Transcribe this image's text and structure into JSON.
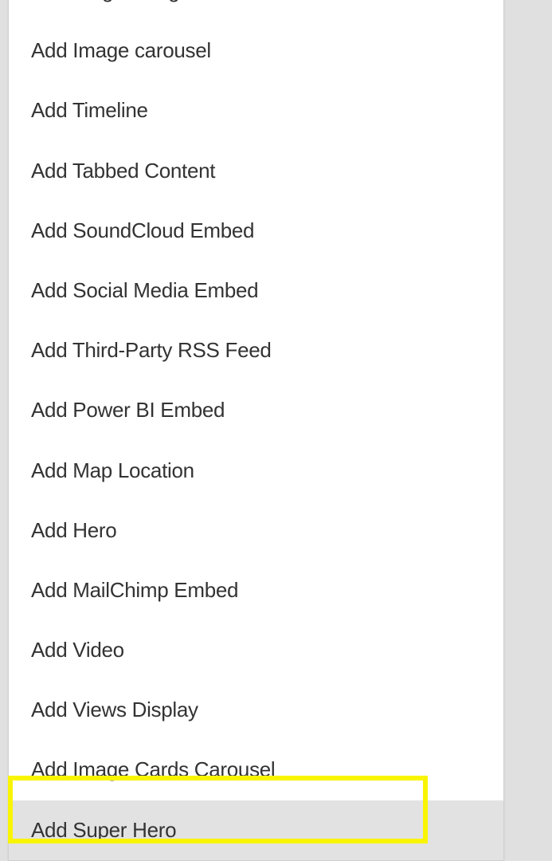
{
  "menu": {
    "items": [
      {
        "label": "Add Single Image",
        "highlighted": false
      },
      {
        "label": "Add Image carousel",
        "highlighted": false
      },
      {
        "label": "Add Timeline",
        "highlighted": false
      },
      {
        "label": "Add Tabbed Content",
        "highlighted": false
      },
      {
        "label": "Add SoundCloud Embed",
        "highlighted": false
      },
      {
        "label": "Add Social Media Embed",
        "highlighted": false
      },
      {
        "label": "Add Third-Party RSS Feed",
        "highlighted": false
      },
      {
        "label": "Add Power BI Embed",
        "highlighted": false
      },
      {
        "label": "Add Map Location",
        "highlighted": false
      },
      {
        "label": "Add Hero",
        "highlighted": false
      },
      {
        "label": "Add MailChimp Embed",
        "highlighted": false
      },
      {
        "label": "Add Video",
        "highlighted": false
      },
      {
        "label": "Add Views Display",
        "highlighted": false
      },
      {
        "label": "Add Image Cards Carousel",
        "highlighted": false
      },
      {
        "label": "Add Super Hero",
        "highlighted": true
      }
    ]
  }
}
